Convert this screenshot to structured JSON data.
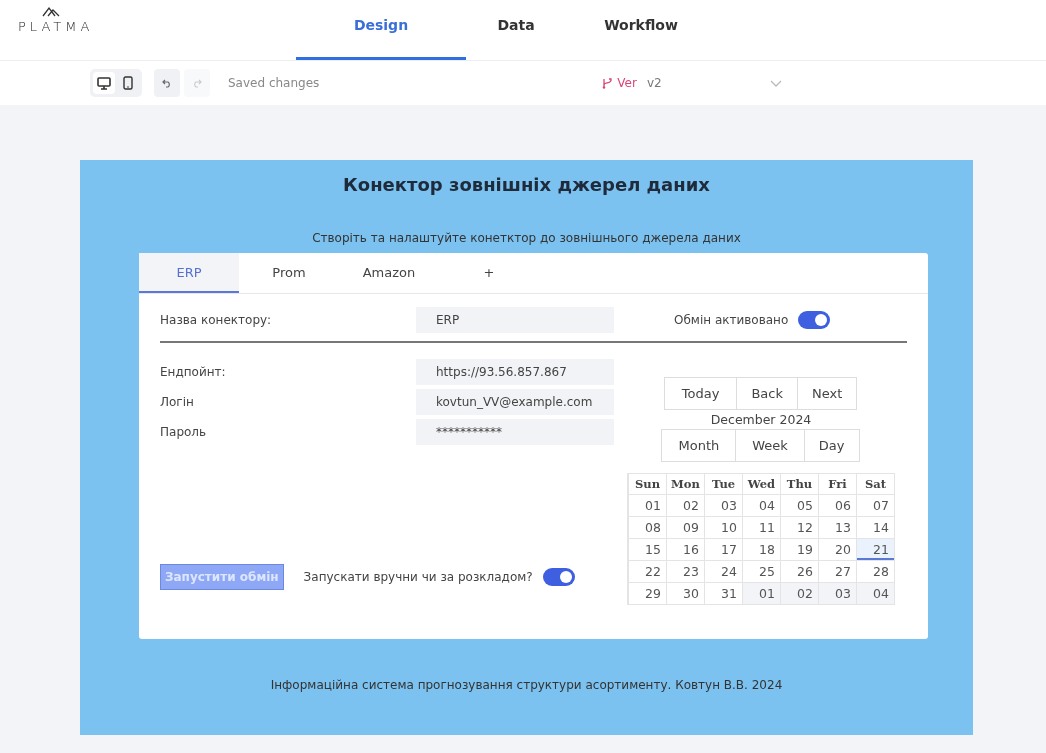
{
  "logo": {
    "text": "PLATMA"
  },
  "nav_tabs": [
    {
      "label": "Design",
      "selected": true
    },
    {
      "label": "Data",
      "selected": false
    },
    {
      "label": "Workflow",
      "selected": false
    }
  ],
  "toolbar": {
    "devices": [
      {
        "kind": "desktop",
        "selected": true
      },
      {
        "kind": "mobile",
        "selected": false
      }
    ],
    "undo": {
      "disabled": false
    },
    "redo": {
      "disabled": true
    },
    "status": "Saved changes",
    "version_label": "Ver",
    "version_value": "v2"
  },
  "page": {
    "title": "Конектор зовнішніх джерел даних",
    "subtitle": "Створіть та налаштуйте конетктор до зовнішнього джерела даних",
    "footer": "Інформаційна система прогнозування структури асортименту. Ковтун В.В. 2024"
  },
  "connector_tabs": [
    {
      "label": "ERP",
      "selected": true
    },
    {
      "label": "Prom",
      "selected": false
    },
    {
      "label": "Amazon",
      "selected": false
    },
    {
      "label": "+",
      "selected": false
    }
  ],
  "name_field": {
    "label": "Назва конектору:",
    "value": "ERP"
  },
  "exchange_toggle": {
    "label": "Обмін активовано",
    "on": true
  },
  "fields": [
    {
      "label": "Ендпойнт:",
      "value": "https://93.56.857.867"
    },
    {
      "label": "Логін",
      "value": "kovtun_VV@example.com"
    },
    {
      "label": "Пароль",
      "value": "***********"
    }
  ],
  "run_button": {
    "label": "Запустити обмін",
    "disabled": true
  },
  "schedule_toggle": {
    "label": "Запускати вручни чи за розкладом?",
    "on": true
  },
  "calendar": {
    "nav_buttons": [
      "Today",
      "Back",
      "Next"
    ],
    "month": "December 2024",
    "views": [
      "Month",
      "Week",
      "Day"
    ],
    "weekdays": [
      "Sun",
      "Mon",
      "Tue",
      "Wed",
      "Thu",
      "Fri",
      "Sat"
    ],
    "weeks": [
      [
        {
          "day": "01",
          "outside": false,
          "today": false
        },
        {
          "day": "02",
          "outside": false,
          "today": false
        },
        {
          "day": "03",
          "outside": false,
          "today": false
        },
        {
          "day": "04",
          "outside": false,
          "today": false
        },
        {
          "day": "05",
          "outside": false,
          "today": false
        },
        {
          "day": "06",
          "outside": false,
          "today": false
        },
        {
          "day": "07",
          "outside": false,
          "today": false
        }
      ],
      [
        {
          "day": "08",
          "outside": false,
          "today": false
        },
        {
          "day": "09",
          "outside": false,
          "today": false
        },
        {
          "day": "10",
          "outside": false,
          "today": false
        },
        {
          "day": "11",
          "outside": false,
          "today": false
        },
        {
          "day": "12",
          "outside": false,
          "today": false
        },
        {
          "day": "13",
          "outside": false,
          "today": false
        },
        {
          "day": "14",
          "outside": false,
          "today": false
        }
      ],
      [
        {
          "day": "15",
          "outside": false,
          "today": false
        },
        {
          "day": "16",
          "outside": false,
          "today": false
        },
        {
          "day": "17",
          "outside": false,
          "today": false
        },
        {
          "day": "18",
          "outside": false,
          "today": false
        },
        {
          "day": "19",
          "outside": false,
          "today": false
        },
        {
          "day": "20",
          "outside": false,
          "today": false
        },
        {
          "day": "21",
          "outside": false,
          "today": true
        }
      ],
      [
        {
          "day": "22",
          "outside": false,
          "today": false
        },
        {
          "day": "23",
          "outside": false,
          "today": false
        },
        {
          "day": "24",
          "outside": false,
          "today": false
        },
        {
          "day": "25",
          "outside": false,
          "today": false
        },
        {
          "day": "26",
          "outside": false,
          "today": false
        },
        {
          "day": "27",
          "outside": false,
          "today": false
        },
        {
          "day": "28",
          "outside": false,
          "today": false
        }
      ],
      [
        {
          "day": "29",
          "outside": false,
          "today": false
        },
        {
          "day": "30",
          "outside": false,
          "today": false
        },
        {
          "day": "31",
          "outside": false,
          "today": false
        },
        {
          "day": "01",
          "outside": true,
          "today": false
        },
        {
          "day": "02",
          "outside": true,
          "today": false
        },
        {
          "day": "03",
          "outside": true,
          "today": false
        },
        {
          "day": "04",
          "outside": true,
          "today": false
        }
      ]
    ]
  }
}
